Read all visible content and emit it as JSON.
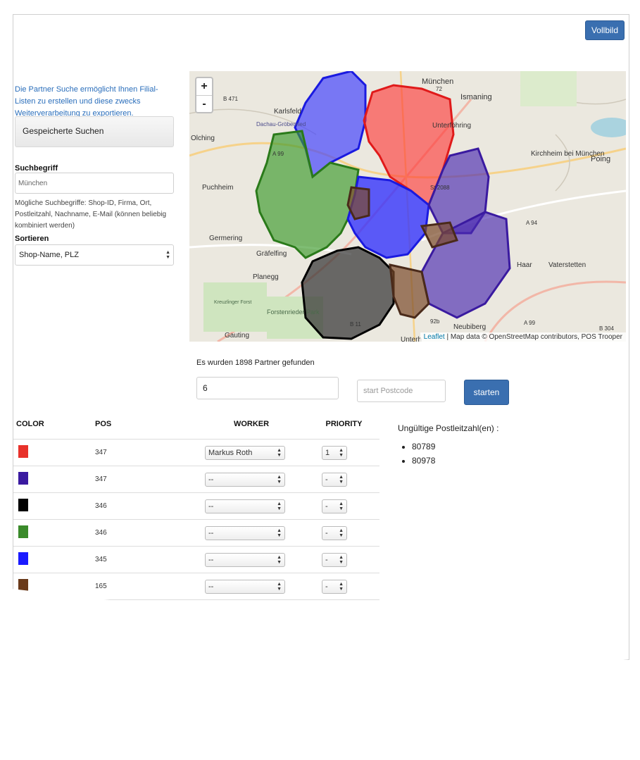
{
  "header": {
    "fullscreen_label": "Vollbild"
  },
  "sidebar": {
    "intro": "Die Partner Suche ermöglicht Ihnen Filial-Listen zu erstellen und diese zwecks Weiterverarbeitung zu exportieren.",
    "saved_searches_label": "Gespeicherte Suchen",
    "search_label": "Suchbegriff",
    "search_value": "München",
    "search_hint": "Mögliche Suchbegriffe: Shop-ID, Firma, Ort, Postleitzahl, Nachname, E-Mail (können beliebig kombiniert werden)",
    "sort_label": "Sortieren",
    "sort_value": "Shop-Name, PLZ"
  },
  "map": {
    "zoom_in": "+",
    "zoom_out": "-",
    "attribution_link": "Leaflet",
    "attribution_text": " | Map data © OpenStreetMap contributors, POS Trooper",
    "places": [
      "München",
      "Ismaning",
      "Karlsfeld",
      "Dachau-Gröbenried",
      "Unterföhring",
      "Kirchheim bei München",
      "Poing",
      "Olching",
      "Puchheim",
      "Germering",
      "Gräfelfing",
      "Planegg",
      "Haar",
      "Vaterstetten",
      "Neubiberg",
      "Kreuzlinger Forst",
      "Forstenrieder Park",
      "Gauting",
      "Unterh"
    ],
    "road_labels": [
      "B 471",
      "A 99",
      "A 94",
      "B 304",
      "A 99",
      "B 11",
      "St 2088",
      "92b",
      "72"
    ]
  },
  "results": {
    "found_text": "Es wurden 1898 Partner gefunden",
    "group_count_value": "6",
    "postcode_placeholder": "start Postcode",
    "start_label": "starten"
  },
  "table": {
    "headers": {
      "color": "COLOR",
      "pos": "POS",
      "worker": "WORKER",
      "priority": "PRIORITY"
    },
    "rows": [
      {
        "color": "#e8312a",
        "pos": "347",
        "worker": "Markus Roth",
        "priority": "1"
      },
      {
        "color": "#3a1aa0",
        "pos": "347",
        "worker": "--",
        "priority": "-"
      },
      {
        "color": "#000000",
        "pos": "346",
        "worker": "--",
        "priority": "-"
      },
      {
        "color": "#3a8a2a",
        "pos": "346",
        "worker": "--",
        "priority": "-"
      },
      {
        "color": "#1a1aff",
        "pos": "345",
        "worker": "--",
        "priority": "-"
      },
      {
        "color": "#6a3a1a",
        "pos": "165",
        "worker": "--",
        "priority": "-"
      }
    ]
  },
  "invalid_postcodes": {
    "title": "Ungültige Postleitzahl(en) :",
    "items": [
      "80789",
      "80978"
    ]
  }
}
